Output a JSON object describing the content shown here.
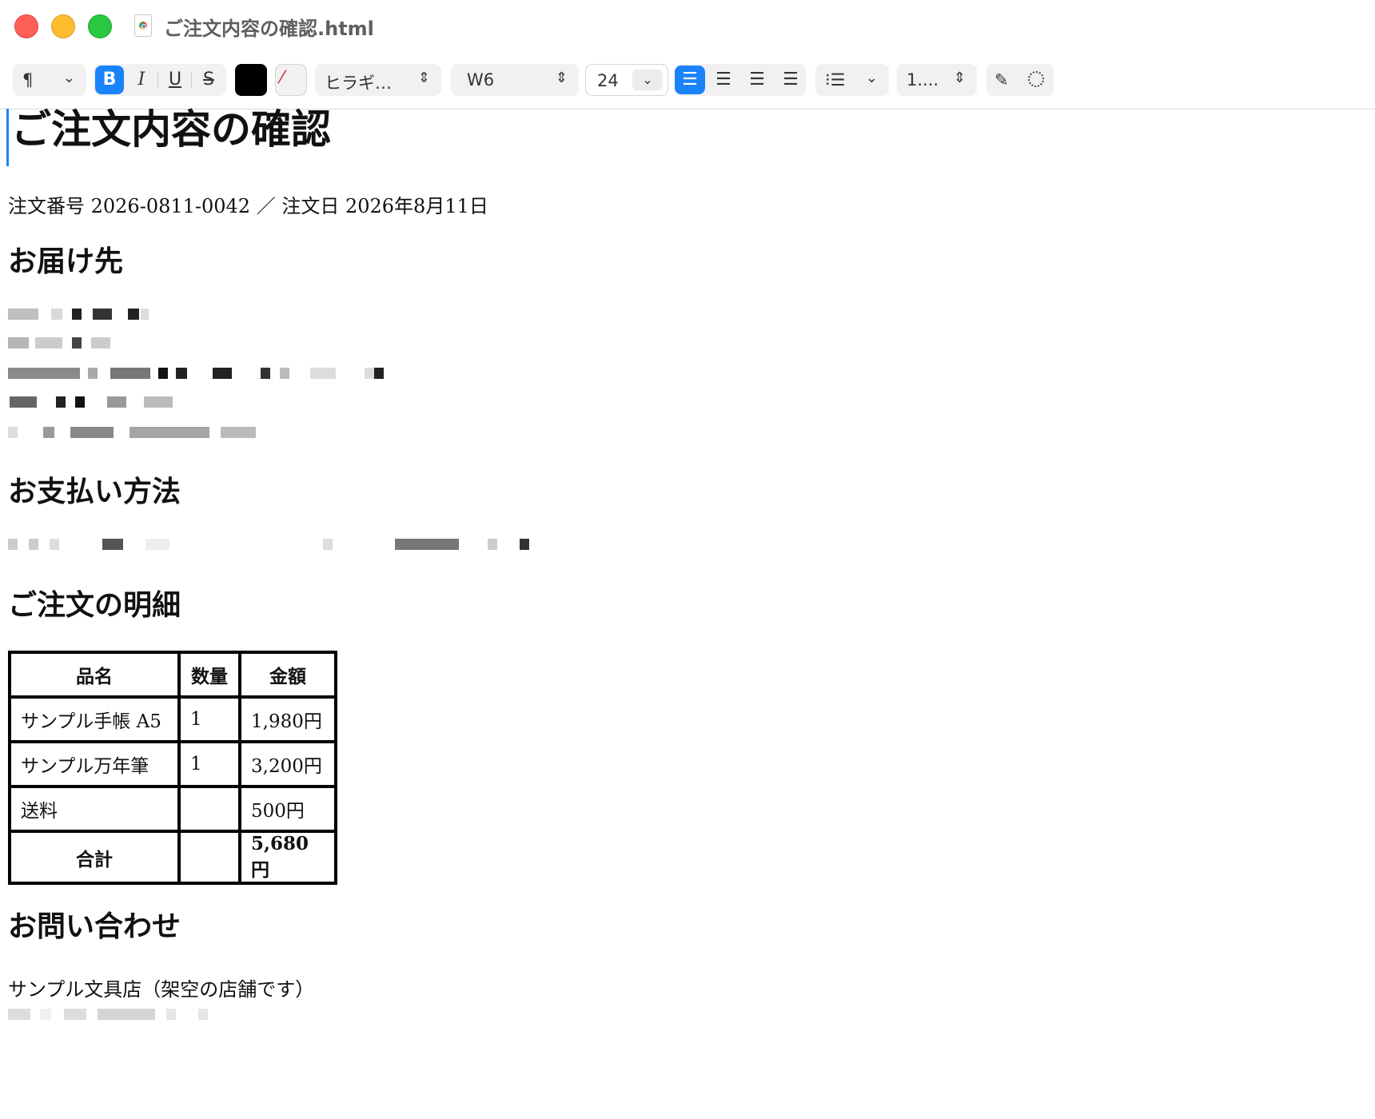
{
  "window": {
    "title": "ご注文内容の確認.html"
  },
  "toolbar": {
    "paragraph_style": "¶",
    "bold": "B",
    "italic": "I",
    "underline": "U",
    "strikethrough": "S",
    "text_color": "#000000",
    "font_family": "ヒラギ…",
    "font_weight": "W6",
    "font_size": "24",
    "numbering": "1....",
    "align_active": "left"
  },
  "document": {
    "title": "ご注文内容の確認",
    "order_line": "注文番号 2026-0811-0042 ／ 注文日 2026年8月11日",
    "shipping_heading": "お届け先",
    "payment_heading": "お支払い方法",
    "items_heading": "ご注文の明細",
    "items_table": {
      "headers": [
        "品名",
        "数量",
        "金額"
      ],
      "rows": [
        {
          "name": "サンプル手帳 A5",
          "qty": "1",
          "amount": "1,980円"
        },
        {
          "name": "サンプル万年筆",
          "qty": "1",
          "amount": "3,200円"
        },
        {
          "name": "送料",
          "qty": "",
          "amount": "500円"
        }
      ],
      "total": {
        "label": "合計",
        "qty": "",
        "amount": "5,680円"
      }
    },
    "contact_heading": "お問い合わせ",
    "shop_name": "サンプル文具店（架空の店舗です）"
  }
}
